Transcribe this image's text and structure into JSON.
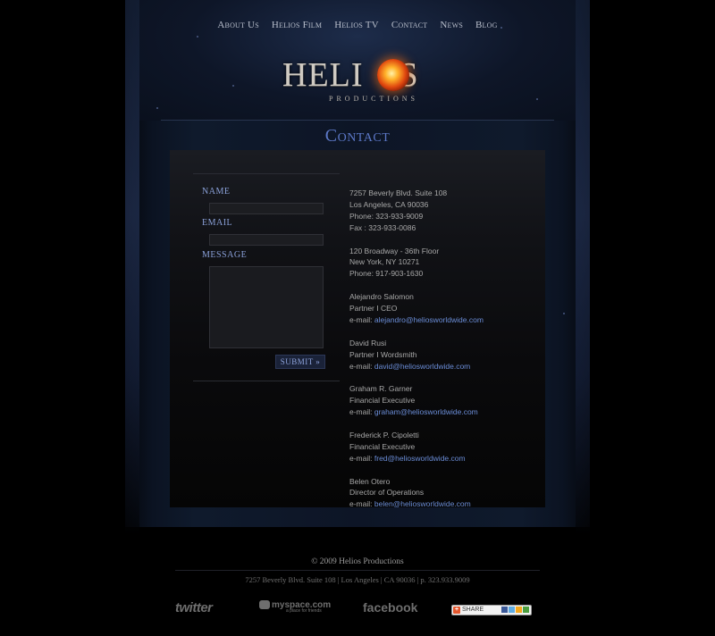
{
  "nav": {
    "items": [
      {
        "label": "About Us"
      },
      {
        "label": "Helios Film"
      },
      {
        "label": "Helios TV"
      },
      {
        "label": "Contact"
      },
      {
        "label": "News"
      },
      {
        "label": "Blog"
      }
    ]
  },
  "logo": {
    "word_left": "HELI",
    "word_right": "S",
    "subtitle": "PRODUCTIONS"
  },
  "page": {
    "title": "Contact"
  },
  "form": {
    "name_label": "NAME",
    "email_label": "EMAIL",
    "message_label": "MESSAGE",
    "submit_label": "SUBMIT »"
  },
  "contacts": {
    "office1": {
      "line1": "7257 Beverly Blvd. Suite 108",
      "line2": "Los Angeles, CA 90036",
      "line3": "Phone: 323-933-9009",
      "line4": "Fax : 323-933-0086"
    },
    "office2": {
      "line1": "120 Broadway - 36th Floor",
      "line2": "New York, NY 10271",
      "line3": "Phone: 917-903-1630"
    },
    "people": [
      {
        "name": "Alejandro Salomon",
        "title": "Partner I CEO",
        "email_prefix": "e-mail: ",
        "email": "alejandro@heliosworldwide.com"
      },
      {
        "name": "David Rusi",
        "title": "Partner I Wordsmith",
        "email_prefix": "e-mail: ",
        "email": "david@heliosworldwide.com"
      },
      {
        "name": "Graham R. Garner",
        "title": "Financial Executive",
        "email_prefix": "e-mail: ",
        "email": "graham@heliosworldwide.com"
      },
      {
        "name": "Frederick P. Cipoletti",
        "title": "Financial Executive",
        "email_prefix": "e-mail: ",
        "email": "fred@heliosworldwide.com"
      },
      {
        "name": "Belen Otero",
        "title": "Director of Operations",
        "email_prefix": "e-mail: ",
        "email": "belen@heliosworldwide.com"
      }
    ]
  },
  "footer": {
    "copyright": "© 2009 Helios Productions",
    "address": "7257 Beverly Blvd. Suite 108 | Los Angeles | CA 90036 | p. 323.933.9009",
    "social": {
      "twitter": "twitter",
      "myspace": "myspace.com",
      "myspace_sub": "a place for friends",
      "facebook": "facebook",
      "share": "SHARE"
    }
  },
  "colors": {
    "accent": "#5c78c7",
    "link": "#6a8cd6",
    "sun": "#e0480f"
  }
}
